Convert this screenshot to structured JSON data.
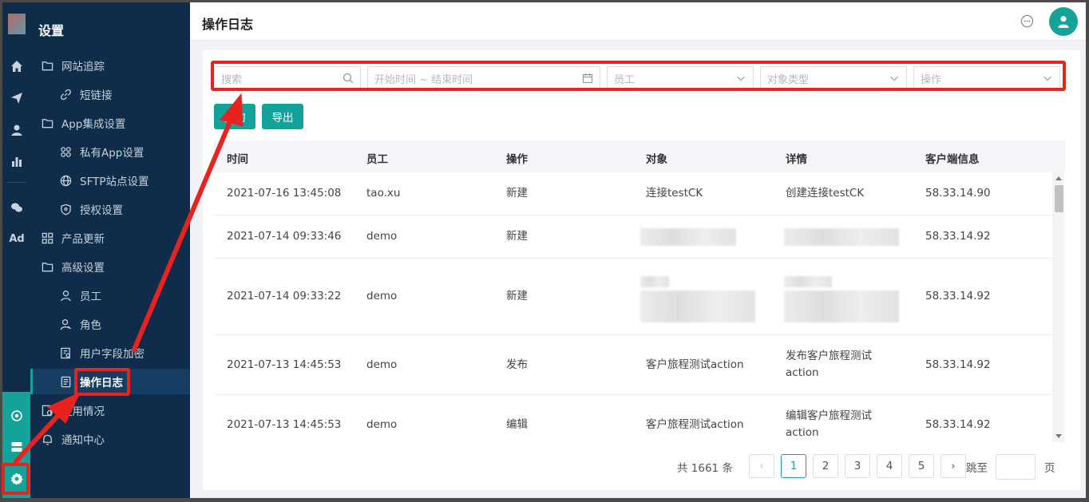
{
  "sidebar": {
    "title": "设置",
    "items": [
      {
        "label": "网站追踪"
      },
      {
        "label": "短链接"
      },
      {
        "label": "App集成设置"
      },
      {
        "label": "私有App设置"
      },
      {
        "label": "SFTP站点设置"
      },
      {
        "label": "授权设置"
      },
      {
        "label": "产品更新"
      },
      {
        "label": "高级设置"
      },
      {
        "label": "员工"
      },
      {
        "label": "角色"
      },
      {
        "label": "用户字段加密"
      },
      {
        "label": "操作日志"
      },
      {
        "label": "使用情况"
      },
      {
        "label": "通知中心"
      }
    ]
  },
  "rail": {
    "ad_label": "Ad"
  },
  "header": {
    "title": "操作日志"
  },
  "filters": {
    "search_placeholder": "搜索",
    "date_placeholder": "开始时间 ~ 结束时间",
    "employee_placeholder": "员工",
    "object_type_placeholder": "对象类型",
    "operation_placeholder": "操作"
  },
  "buttons": {
    "query": "查询",
    "export": "导出"
  },
  "table": {
    "columns": [
      "时间",
      "员工",
      "操作",
      "对象",
      "详情",
      "客户端信息"
    ],
    "rows": [
      {
        "time": "2021-07-16 13:45:08",
        "employee": "tao.xu",
        "op": "新建",
        "object": "连接testCK",
        "detail": "创建连接testCK",
        "detail2": "",
        "client": "58.33.14.90"
      },
      {
        "time": "2021-07-14 09:33:46",
        "employee": "demo",
        "op": "新建",
        "object": "",
        "detail": "",
        "detail2": "",
        "client": "58.33.14.92"
      },
      {
        "time": "2021-07-14 09:33:22",
        "employee": "demo",
        "op": "新建",
        "object": "",
        "detail": "",
        "detail2": "",
        "client": "58.33.14.92"
      },
      {
        "time": "2021-07-13 14:45:53",
        "employee": "demo",
        "op": "发布",
        "object": "客户旅程测试action",
        "detail": "发布客户旅程测试",
        "detail2": "action",
        "client": "58.33.14.92"
      },
      {
        "time": "2021-07-13 14:45:53",
        "employee": "demo",
        "op": "编辑",
        "object": "客户旅程测试action",
        "detail": "编辑客户旅程测试",
        "detail2": "action",
        "client": "58.33.14.92"
      }
    ]
  },
  "pagination": {
    "total": "共 1661 条",
    "pages": [
      "1",
      "2",
      "3",
      "4",
      "5"
    ],
    "current": "1",
    "prev": "‹",
    "next": "›",
    "jump_label": "跳至",
    "page_suffix": "页"
  },
  "colors": {
    "accent": "#14a39a",
    "sidebar_bg": "#0f2d4a",
    "highlight": "#e8231f"
  }
}
